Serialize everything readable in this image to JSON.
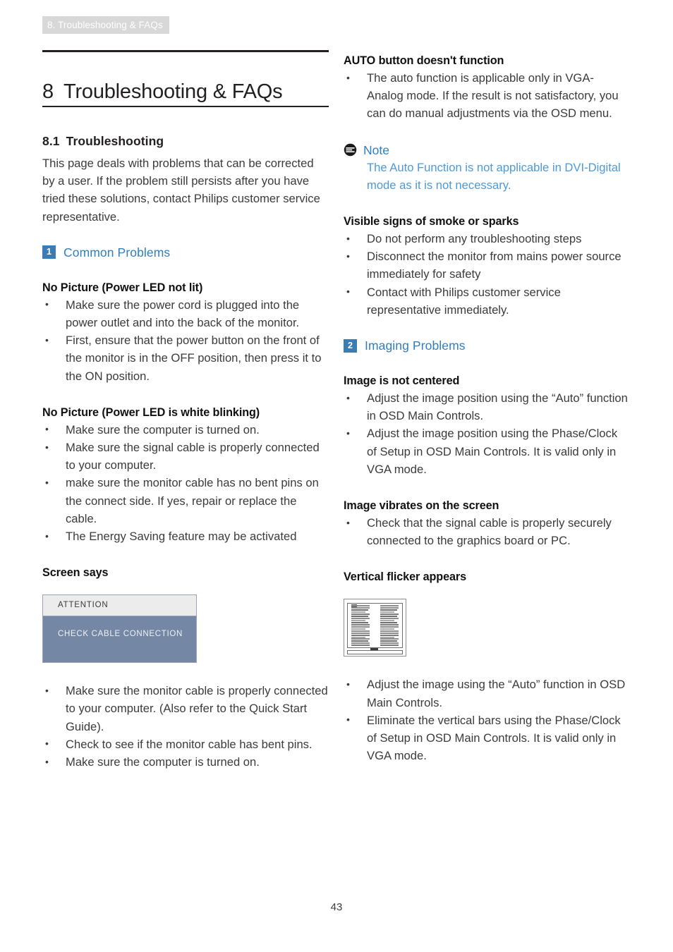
{
  "header": {
    "running_head": "8. Troubleshooting & FAQs"
  },
  "chapter": {
    "number": "8",
    "title": "Troubleshooting & FAQs"
  },
  "section": {
    "number": "8.1",
    "title": "Troubleshooting"
  },
  "intro": "This page deals with problems that can be corrected by a user. If the problem still persists after you have tried these solutions, contact Philips customer service representative.",
  "left_column": {
    "common_problems": {
      "badge": "1",
      "label": "Common Problems"
    },
    "no_picture_led_not_lit": {
      "heading": "No Picture (Power LED not lit)",
      "bullets": [
        "Make sure the power cord is plugged into the power outlet and into the back of the monitor.",
        "First, ensure that the power button on the front of the monitor is in the OFF position, then press it to the ON position."
      ]
    },
    "no_picture_led_blinking": {
      "heading": "No Picture (Power LED is white blinking)",
      "bullets": [
        "Make sure the computer is turned on.",
        "Make sure the signal cable is properly connected to your computer.",
        "make sure the monitor cable has no bent pins on the connect side. If yes, repair or replace the cable.",
        "The Energy Saving feature may be activated"
      ]
    },
    "screen_says": {
      "heading": "Screen says",
      "osd": {
        "title": "ATTENTION",
        "message": "CHECK CABLE CONNECTION",
        "title_bg": "#ececec",
        "body_bg": "#7487a4"
      },
      "bullets": [
        "Make sure the monitor cable is properly connected to your computer. (Also refer to the Quick Start Guide).",
        "Check to see if the monitor cable has bent pins.",
        "Make sure the computer is turned on."
      ]
    }
  },
  "right_column": {
    "auto_button": {
      "heading": "AUTO button doesn't function",
      "bullets": [
        "The auto function is applicable only in VGA-Analog mode.  If the result is not satisfactory, you can do manual adjustments via the OSD menu."
      ]
    },
    "note": {
      "icon": "note-icon",
      "title": "Note",
      "body": "The Auto Function is not applicable in DVI-Digital mode as it is not necessary.",
      "color": "#4d9ad8"
    },
    "smoke_or_sparks": {
      "heading": "Visible signs of smoke or sparks",
      "bullets": [
        "Do not perform any troubleshooting steps",
        "Disconnect the monitor from mains power source immediately for safety",
        "Contact with Philips customer service representative immediately."
      ]
    },
    "imaging_problems": {
      "badge": "2",
      "label": "Imaging Problems"
    },
    "image_not_centered": {
      "heading": "Image is not centered",
      "bullets": [
        "Adjust the image position using the “Auto” function in OSD Main Controls.",
        "Adjust the image position using the Phase/Clock of Setup in OSD Main Controls.  It is valid only in VGA mode."
      ]
    },
    "image_vibrates": {
      "heading": "Image vibrates on the screen",
      "bullets": [
        "Check that the signal cable is properly securely connected to the graphics board or PC."
      ]
    },
    "vertical_flicker": {
      "heading": "Vertical flicker appears",
      "figure": "vertical-flicker-illustration",
      "bullets": [
        "Adjust the image using the “Auto” function in OSD Main Controls.",
        "Eliminate the vertical bars using the Phase/Clock of Setup in OSD Main Controls. It is valid only in VGA mode."
      ]
    }
  },
  "footer": {
    "page_number": "43"
  },
  "colors": {
    "accent_blue": "#2f7fc1",
    "badge_blue": "#3c7cb4",
    "note_text": "#4d9ad8",
    "header_tab_bg": "#d8d8d8"
  }
}
